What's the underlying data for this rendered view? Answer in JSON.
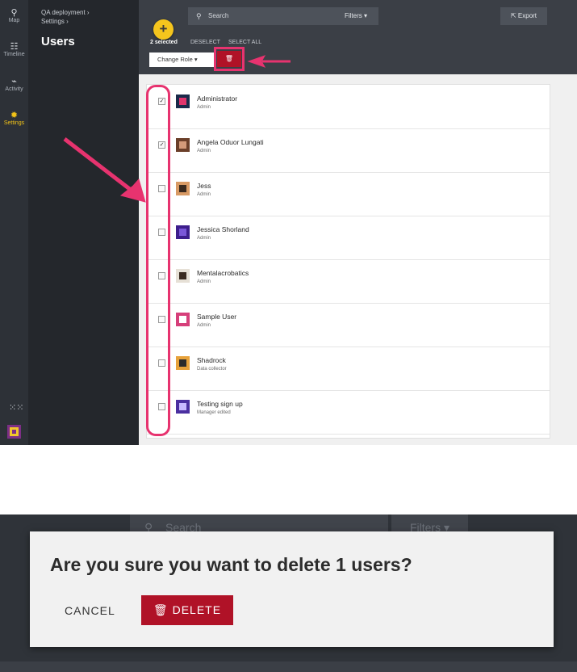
{
  "rail": {
    "items": [
      {
        "icon": "location-pin-icon",
        "label": "Map"
      },
      {
        "icon": "timeline-icon",
        "label": "Timeline"
      },
      {
        "icon": "activity-icon",
        "label": "Activity"
      },
      {
        "icon": "gear-icon",
        "label": "Settings"
      }
    ]
  },
  "breadcrumb": {
    "project": "QA deployment",
    "section": "Settings"
  },
  "page_title": "Users",
  "toolbar": {
    "search_placeholder": "Search",
    "filters_label": "Filters",
    "export_label": "Export",
    "add_symbol": "+",
    "selected_label": "2 selected",
    "deselect_label": "DESELECT",
    "select_all_label": "SELECT ALL",
    "change_role_label": "Change Role"
  },
  "users": [
    {
      "name": "Administrator",
      "role": "Admin",
      "checked": true,
      "avatar_colors": [
        "#1a2a4a",
        "#e0356c"
      ]
    },
    {
      "name": "Angela Oduor Lungati",
      "role": "Admin",
      "checked": true,
      "avatar_colors": [
        "#6b3f2a",
        "#d49a7a"
      ]
    },
    {
      "name": "Jess",
      "role": "Admin",
      "checked": false,
      "avatar_colors": [
        "#d89a64",
        "#3a2a1e"
      ]
    },
    {
      "name": "Jessica Shorland",
      "role": "Admin",
      "checked": false,
      "avatar_colors": [
        "#3d1e8c",
        "#7a57d8"
      ]
    },
    {
      "name": "Mentalacrobatics",
      "role": "Admin",
      "checked": false,
      "avatar_colors": [
        "#e6e0d6",
        "#3a2a20"
      ]
    },
    {
      "name": "Sample User",
      "role": "Admin",
      "checked": false,
      "avatar_colors": [
        "#d63f7a",
        "#ffffff"
      ]
    },
    {
      "name": "Shadrock",
      "role": "Data collector",
      "checked": false,
      "avatar_colors": [
        "#e7a23b",
        "#2b2b2b"
      ]
    },
    {
      "name": "Testing sign up",
      "role": "Manager edited",
      "checked": false,
      "avatar_colors": [
        "#4b2fa0",
        "#c9b9ff"
      ]
    }
  ],
  "dialog": {
    "background_search": "Search",
    "background_filters": "Filters",
    "title": "Are you sure you want to delete 1 users?",
    "cancel_label": "CANCEL",
    "delete_label": "DELETE"
  },
  "colors": {
    "accent": "#f5c51d",
    "danger": "#b01227",
    "highlight": "#e7336f"
  }
}
